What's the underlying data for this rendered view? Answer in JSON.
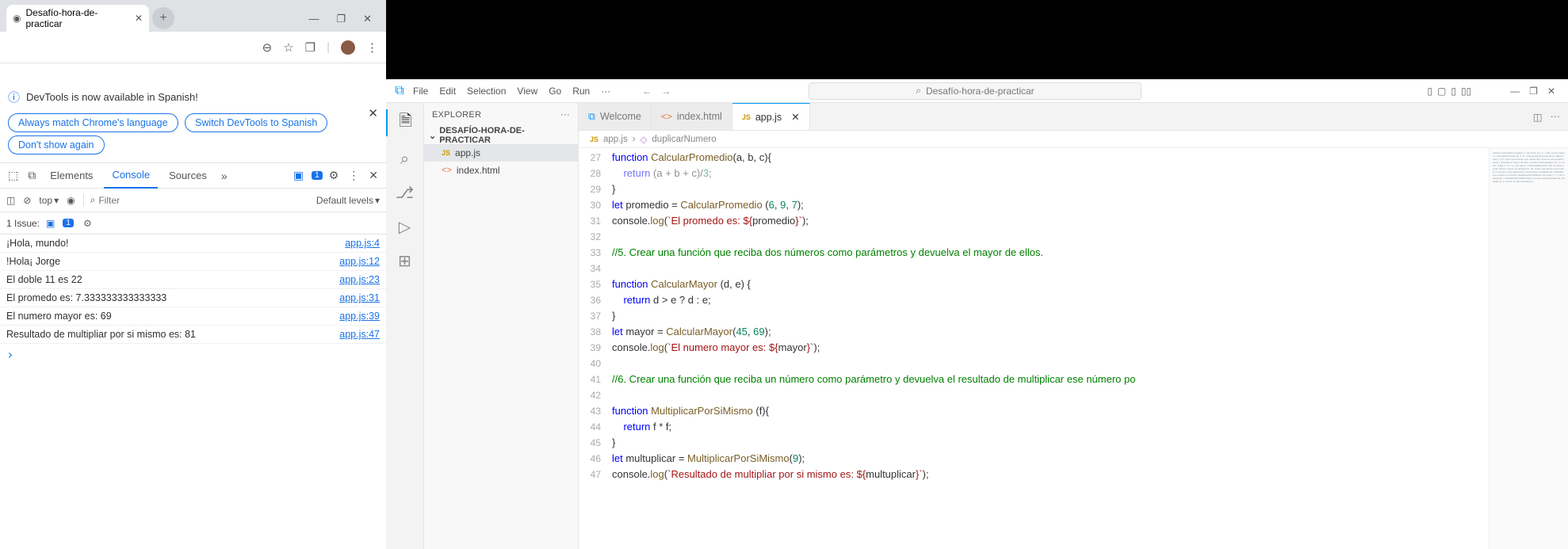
{
  "chrome": {
    "tab_title": "Desafío-hora-de-practicar",
    "win_min": "—",
    "win_max": "❐",
    "win_close": "✕",
    "toolbar": {
      "zoom": "⊖",
      "star": "☆",
      "ext": "❐",
      "avatar": "",
      "more": "⋮"
    }
  },
  "devtools": {
    "notice": {
      "text": "DevTools is now available in Spanish!",
      "chip_match": "Always match Chrome's language",
      "chip_switch": "Switch DevTools to Spanish",
      "chip_dont": "Don't show again"
    },
    "tabs": {
      "elements": "Elements",
      "console": "Console",
      "sources": "Sources"
    },
    "errors_badge": "1",
    "console_bar": {
      "context": "top",
      "filter_ph": "Filter",
      "levels": "Default levels"
    },
    "issues": {
      "label": "1 Issue:",
      "badge": "1"
    },
    "logs": [
      {
        "msg": "¡Hola, mundo!",
        "src": "app.js:4"
      },
      {
        "msg": "!Hola¡ Jorge",
        "src": "app.js:12"
      },
      {
        "msg": "El doble 11 es 22",
        "src": "app.js:23"
      },
      {
        "msg": "El promedo es: 7.333333333333333",
        "src": "app.js:31"
      },
      {
        "msg": "El numero mayor es: 69",
        "src": "app.js:39"
      },
      {
        "msg": "Resultado de multipliar por si mismo es: 81",
        "src": "app.js:47"
      }
    ]
  },
  "vscode": {
    "menus": [
      "File",
      "Edit",
      "Selection",
      "View",
      "Go",
      "Run",
      "···"
    ],
    "search": "Desafío-hora-de-practicar",
    "layout_icons": [
      "▯",
      "▢",
      "▯",
      "▯▯"
    ],
    "win": [
      "—",
      "❐",
      "✕"
    ],
    "explorer": {
      "title": "EXPLORER",
      "folder": "DESAFÍO-HORA-DE-PRACTICAR",
      "files": [
        {
          "icon": "JS",
          "name": "app.js",
          "selected": true
        },
        {
          "icon": "<>",
          "name": "index.html",
          "selected": false
        }
      ]
    },
    "tabs": [
      {
        "icon": "vs",
        "label": "Welcome",
        "active": false,
        "close": false
      },
      {
        "icon": "ht",
        "label": "index.html",
        "active": false,
        "close": false
      },
      {
        "icon": "js",
        "label": "app.js",
        "active": true,
        "close": true
      }
    ],
    "breadcrumb": [
      "app.js",
      "duplicarNumero"
    ],
    "code": [
      {
        "n": 27,
        "html": "<span class='kw'>function</span> <span class='fn'>CalcularPromedio</span>(a, b, c){"
      },
      {
        "n": 28,
        "html": "    <span class='kw'>return</span> (a + b + c)/<span class='num'>3</span>;",
        "dim": true
      },
      {
        "n": 29,
        "html": "}"
      },
      {
        "n": 30,
        "html": "<span class='kw'>let</span> promedio = <span class='fn'>CalcularPromedio</span> (<span class='num'>6</span>, <span class='num'>9</span>, <span class='num'>7</span>);"
      },
      {
        "n": 31,
        "html": "console.<span class='fn'>log</span>(<span class='str'>`El promedo es: ${</span>promedio<span class='str'>}`</span>);"
      },
      {
        "n": 32,
        "html": ""
      },
      {
        "n": 33,
        "html": "<span class='cm'>//5. Crear una función que reciba dos números como parámetros y devuelva el mayor de ellos.</span>"
      },
      {
        "n": 34,
        "html": ""
      },
      {
        "n": 35,
        "html": "<span class='kw'>function</span> <span class='fn'>CalcularMayor</span> (d, e) {"
      },
      {
        "n": 36,
        "html": "    <span class='kw'>return</span> d &gt; e ? d : e;"
      },
      {
        "n": 37,
        "html": "}"
      },
      {
        "n": 38,
        "html": "<span class='kw'>let</span> mayor = <span class='fn'>CalcularMayor</span>(<span class='num'>45</span>, <span class='num'>69</span>);"
      },
      {
        "n": 39,
        "html": "console.<span class='fn'>log</span>(<span class='str'>`El numero mayor es: ${</span>mayor<span class='str'>}`</span>);"
      },
      {
        "n": 40,
        "html": ""
      },
      {
        "n": 41,
        "html": "<span class='cm'>//6. Crear una función que reciba un número como parámetro y devuelva el resultado de multiplicar ese número po</span>"
      },
      {
        "n": 42,
        "html": ""
      },
      {
        "n": 43,
        "html": "<span class='kw'>function</span> <span class='fn'>MultiplicarPorSiMismo</span> (f){"
      },
      {
        "n": 44,
        "html": "    <span class='kw'>return</span> f * f;"
      },
      {
        "n": 45,
        "html": "}"
      },
      {
        "n": 46,
        "html": "<span class='kw'>let</span> multuplicar = <span class='fn'>MultiplicarPorSiMismo</span>(<span class='num'>9</span>);"
      },
      {
        "n": 47,
        "html": "console.<span class='fn'>log</span>(<span class='str'>`Resultado de multipliar por si mismo es: ${</span>multuplicar<span class='str'>}`</span>);"
      }
    ]
  }
}
